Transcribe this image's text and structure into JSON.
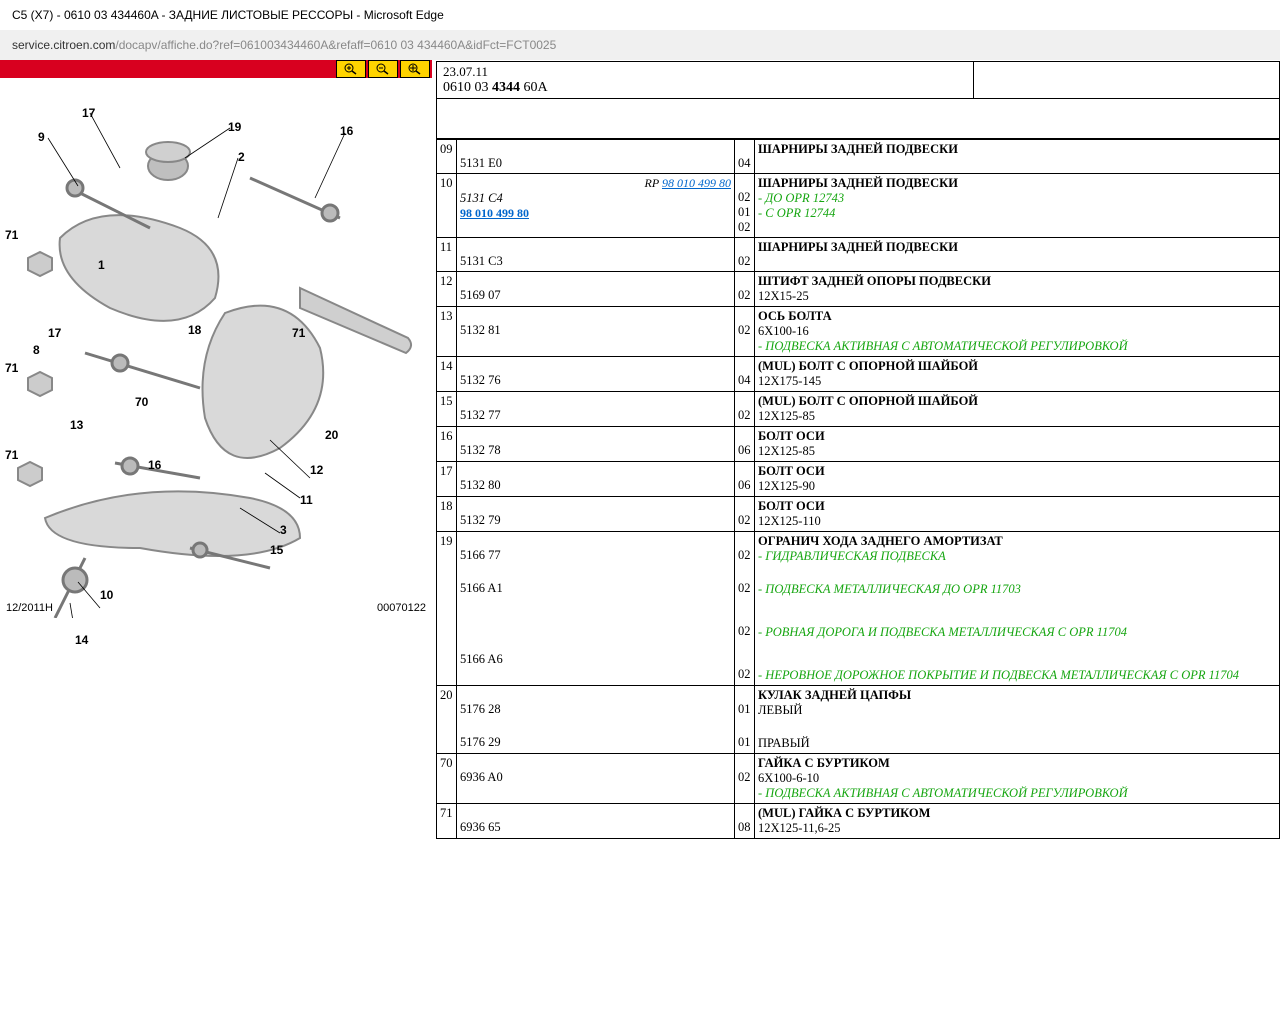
{
  "window": {
    "title": "C5 (X7) - 0610 03 434460A - ЗАДНИЕ ЛИСТОВЫЕ РЕССОРЫ - Microsoft Edge"
  },
  "url": {
    "domain": "service.citroen.com",
    "path": "/docapv/affiche.do?ref=061003434460A&refaff=0610 03 434460A&idFct=FCT0025"
  },
  "header": {
    "date": "23.07.11",
    "ref_pre": "0610 03 ",
    "ref_bold": "4344",
    "ref_post": " 60A"
  },
  "diagram": {
    "bl": "12/2011H",
    "br": "00070122",
    "callouts": [
      "1",
      "2",
      "3",
      "8",
      "9",
      "10",
      "11",
      "12",
      "13",
      "14",
      "15",
      "16",
      "17",
      "18",
      "19",
      "20",
      "70",
      "71"
    ]
  },
  "rows": [
    {
      "n": "09",
      "items": [
        {
          "ref": "5131 E0",
          "q": "04",
          "desc": "ШАРНИРЫ ЗАДНЕЙ ПОДВЕСКИ"
        }
      ]
    },
    {
      "n": "10",
      "rp": "98 010 499 80",
      "items": [
        {
          "ref": "5131 C4",
          "refItalic": true,
          "q": "02",
          "desc": "ШАРНИРЫ ЗАДНЕЙ ПОДВЕСКИ",
          "greens": [
            "- ДО OPR 12743"
          ]
        },
        {
          "link": "98 010 499 80",
          "q": "01"
        },
        {
          "q": "02",
          "greens": [
            "- C OPR 12744"
          ]
        }
      ]
    },
    {
      "n": "11",
      "items": [
        {
          "ref": "5131 C3",
          "q": "02",
          "desc": "ШАРНИРЫ ЗАДНЕЙ ПОДВЕСКИ"
        }
      ]
    },
    {
      "n": "12",
      "items": [
        {
          "ref": "5169 07",
          "q": "02",
          "desc": "ШТИФТ ЗАДНЕЙ ОПОРЫ ПОДВЕСКИ",
          "sub": "12X15-25"
        }
      ]
    },
    {
      "n": "13",
      "items": [
        {
          "ref": "5132 81",
          "q": "02",
          "desc": "ОСЬ БОЛТА",
          "sub": "6X100-16",
          "greens": [
            "- ПОДВЕСКА АКТИВНАЯ С АВТОМАТИЧЕСКОЙ РЕГУЛИРОВКОЙ"
          ]
        }
      ]
    },
    {
      "n": "14",
      "items": [
        {
          "ref": "5132 76",
          "q": "04",
          "desc": "(MUL) БОЛТ С ОПОРНОЙ ШАЙБОЙ",
          "sub": "12X175-145"
        }
      ]
    },
    {
      "n": "15",
      "items": [
        {
          "ref": "5132 77",
          "q": "02",
          "desc": "(MUL) БОЛТ С ОПОРНОЙ ШАЙБОЙ",
          "sub": "12X125-85"
        }
      ]
    },
    {
      "n": "16",
      "items": [
        {
          "ref": "5132 78",
          "q": "06",
          "desc": "БОЛТ ОСИ",
          "sub": "12X125-85"
        }
      ]
    },
    {
      "n": "17",
      "items": [
        {
          "ref": "5132 80",
          "q": "06",
          "desc": "БОЛТ ОСИ",
          "sub": "12X125-90"
        }
      ]
    },
    {
      "n": "18",
      "items": [
        {
          "ref": "5132 79",
          "q": "02",
          "desc": "БОЛТ ОСИ",
          "sub": "12X125-110"
        }
      ]
    },
    {
      "n": "19",
      "items": [
        {
          "ref": "5166 77",
          "q": "02",
          "desc": "ОГРАНИЧ ХОДА ЗАДНЕГО АМОРТИЗАТ",
          "greens": [
            "- ГИДРАВЛИЧЕСКАЯ ПОДВЕСКА"
          ]
        },
        {
          "ref": "5166 A1",
          "q": "02",
          "greens": [
            "- ПОДВЕСКА МЕТАЛЛИЧЕСКАЯ ДО OPR 11703"
          ],
          "gap": 18
        },
        {
          "q": "02",
          "greens": [
            "- РОВНАЯ ДОРОГА И ПОДВЕСКА МЕТАЛЛИЧЕСКАЯ С OPR 11704"
          ],
          "gap": 28
        },
        {
          "ref": "5166 A6",
          "q": "02",
          "greens": [
            "- НЕРОВНОЕ ДОРОЖНОЕ ПОКРЫТИЕ И ПОДВЕСКА МЕТАЛЛИЧЕСКАЯ С OPR 11704"
          ],
          "gap": 28
        }
      ]
    },
    {
      "n": "20",
      "items": [
        {
          "ref": "5176 28",
          "q": "01",
          "desc": "КУЛАК ЗАДНЕЙ ЦАПФЫ",
          "sub": "ЛЕВЫЙ"
        },
        {
          "ref": "5176 29",
          "q": "01",
          "sub": "ПРАВЫЙ",
          "gap": 18
        }
      ]
    },
    {
      "n": "70",
      "items": [
        {
          "ref": "6936 A0",
          "q": "02",
          "desc": "ГАЙКА С БУРТИКОМ",
          "sub": "6X100-6-10",
          "greens": [
            "- ПОДВЕСКА АКТИВНАЯ С АВТОМАТИЧЕСКОЙ РЕГУЛИРОВКОЙ"
          ]
        }
      ]
    },
    {
      "n": "71",
      "items": [
        {
          "ref": "6936 65",
          "q": "08",
          "desc": "(MUL) ГАЙКА С БУРТИКОМ",
          "sub": "12X125-11,6-25"
        }
      ]
    }
  ]
}
